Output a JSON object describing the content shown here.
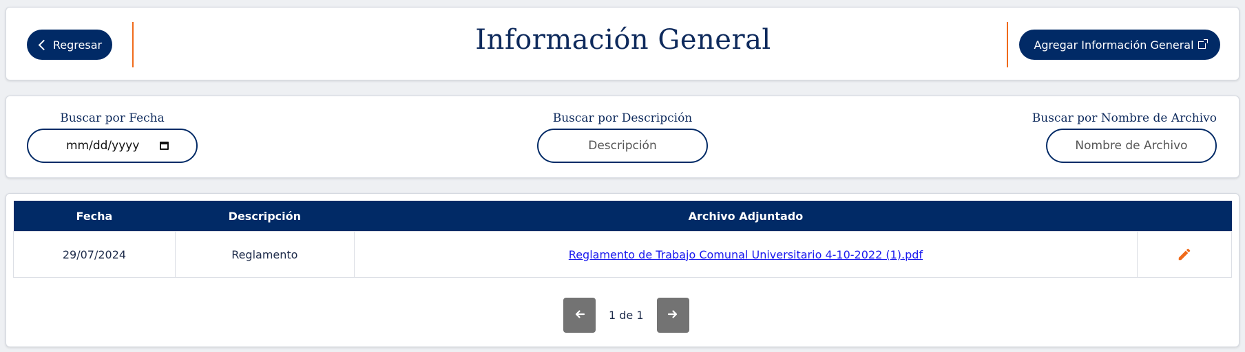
{
  "header": {
    "back_label": "Regresar",
    "title": "Información General",
    "add_label": "Agregar Información General"
  },
  "filters": {
    "fecha": {
      "label": "Buscar por Fecha",
      "placeholder": "mm/dd/yyyy"
    },
    "descripcion": {
      "label": "Buscar por Descripción",
      "placeholder": "Descripción"
    },
    "archivo": {
      "label": "Buscar por Nombre de Archivo",
      "placeholder": "Nombre de Archivo"
    }
  },
  "table": {
    "columns": [
      "Fecha",
      "Descripción",
      "Archivo Adjuntado",
      ""
    ],
    "rows": [
      {
        "fecha": "29/07/2024",
        "descripcion": "Reglamento",
        "archivo": "Reglamento de Trabajo Comunal Universitario 4-10-2022 (1).pdf",
        "action_icon": "pencil-icon"
      }
    ]
  },
  "pagination": {
    "info": "1 de 1",
    "prev_icon": "arrow-left-icon",
    "next_icon": "arrow-right-icon"
  },
  "colors": {
    "primary": "#012a66",
    "accent": "#f06a1a",
    "link": "#1a1aee",
    "pager": "#737373"
  }
}
